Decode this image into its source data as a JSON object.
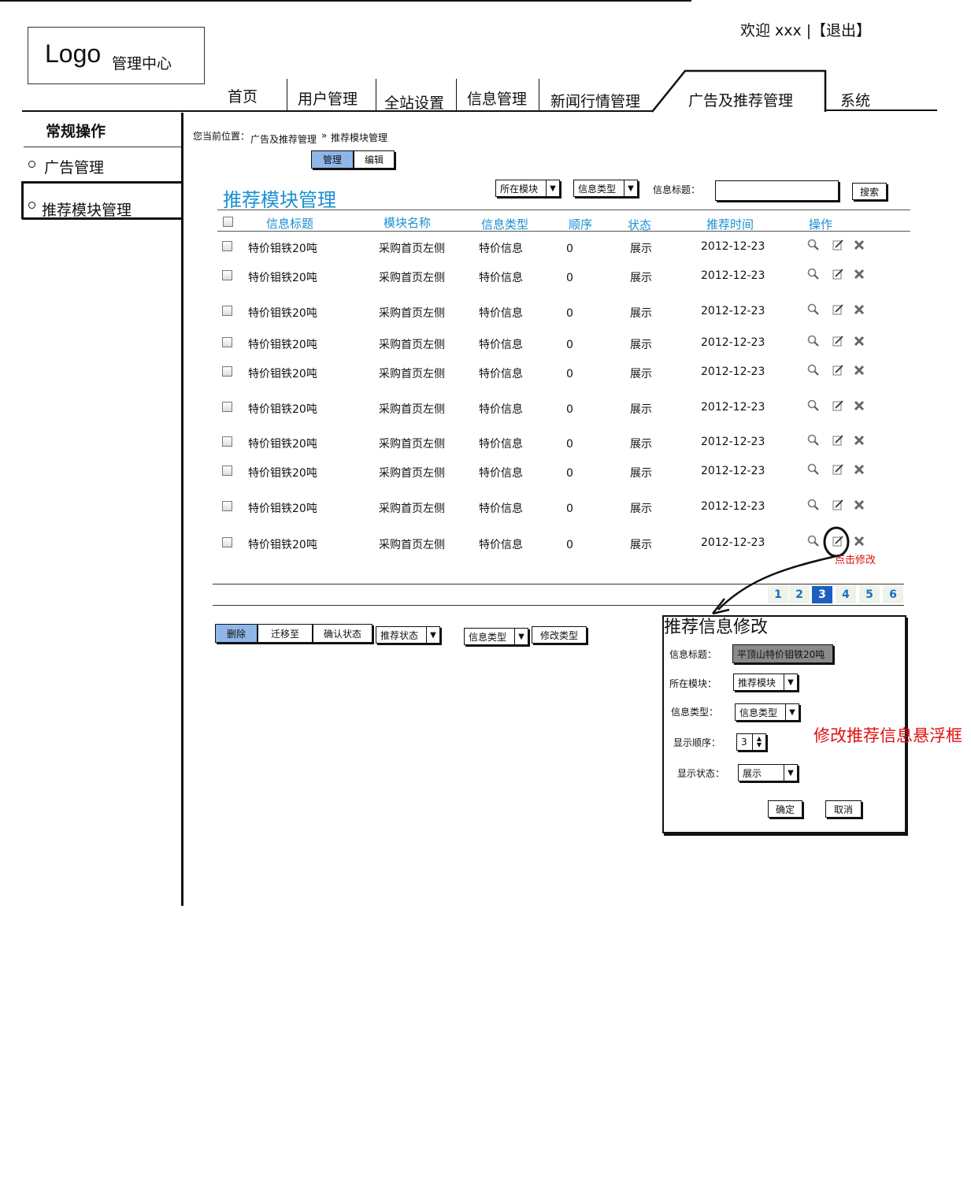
{
  "header": {
    "logo": "Logo",
    "logo_sub": "管理中心",
    "welcome": "欢迎 xxx |",
    "logout": "【退出】"
  },
  "nav": {
    "tabs": [
      "首页",
      "用户管理",
      "全站设置",
      "信息管理",
      "新闻行情管理",
      "广告及推荐管理",
      "系统"
    ],
    "active": "广告及推荐管理"
  },
  "sidebar": {
    "title": "常规操作",
    "items": [
      "广告管理",
      "推荐模块管理"
    ]
  },
  "breadcrumb": {
    "label": "您当前位置：",
    "parent": "广告及推荐管理",
    "sep": "»",
    "current": "推荐模块管理"
  },
  "mode_tabs": [
    "管理",
    "编辑"
  ],
  "page_title": "推荐模块管理",
  "filters": {
    "module_select": "所在模块",
    "type_select": "信息类型",
    "title_label": "信息标题：",
    "title_value": "",
    "search_button": "搜索"
  },
  "table": {
    "headers": [
      "信息标题",
      "模块名称",
      "信息类型",
      "顺序",
      "状态",
      "推荐时间",
      "操作"
    ],
    "rows": [
      [
        "特价钼铁20吨",
        "采购首页左侧",
        "特价信息",
        "0",
        "展示",
        "2012-12-23"
      ],
      [
        "特价钼铁20吨",
        "采购首页左侧",
        "特价信息",
        "0",
        "展示",
        "2012-12-23"
      ],
      [
        "特价钼铁20吨",
        "采购首页左侧",
        "特价信息",
        "0",
        "展示",
        "2012-12-23"
      ],
      [
        "特价钼铁20吨",
        "采购首页左侧",
        "特价信息",
        "0",
        "展示",
        "2012-12-23"
      ],
      [
        "特价钼铁20吨",
        "采购首页左侧",
        "特价信息",
        "0",
        "展示",
        "2012-12-23"
      ],
      [
        "特价钼铁20吨",
        "采购首页左侧",
        "特价信息",
        "0",
        "展示",
        "2012-12-23"
      ],
      [
        "特价钼铁20吨",
        "采购首页左侧",
        "特价信息",
        "0",
        "展示",
        "2012-12-23"
      ],
      [
        "特价钼铁20吨",
        "采购首页左侧",
        "特价信息",
        "0",
        "展示",
        "2012-12-23"
      ],
      [
        "特价钼铁20吨",
        "采购首页左侧",
        "特价信息",
        "0",
        "展示",
        "2012-12-23"
      ],
      [
        "特价钼铁20吨",
        "采购首页左侧",
        "特价信息",
        "0",
        "展示",
        "2012-12-23"
      ]
    ],
    "action_icons": [
      "search-icon",
      "edit-icon",
      "delete-icon"
    ]
  },
  "pagination": {
    "pages": [
      "1",
      "2",
      "3",
      "4",
      "5",
      "6"
    ],
    "current": "3"
  },
  "bulk_actions": {
    "delete": "删除",
    "move_to": "迁移至",
    "confirm_status": "确认状态",
    "rec_status_select": "推荐状态",
    "info_type_select": "信息类型",
    "change_type": "修改类型"
  },
  "annotation": {
    "click_edit": "点击修改",
    "popup_note": "修改推荐信息悬浮框"
  },
  "modal": {
    "title": "推荐信息修改",
    "fields": {
      "title_label": "信息标题：",
      "title_value": "平顶山特价钼铁20吨",
      "module_label": "所在模块：",
      "module_value": "推荐模块",
      "type_label": "信息类型：",
      "type_value": "信息类型",
      "order_label": "显示顺序：",
      "order_value": "3",
      "status_label": "显示状态：",
      "status_value": "展示"
    },
    "ok": "确定",
    "cancel": "取消"
  },
  "colors": {
    "accent": "#1a8fd1",
    "selected_button": "#8fb6e8",
    "annotation": "#dd1111",
    "page_current": "#1f5fbf"
  }
}
